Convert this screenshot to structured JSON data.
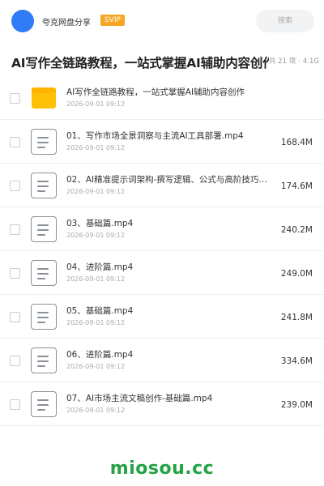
{
  "header": {
    "site_name": "夸克网盘分享",
    "badge": "SVIP",
    "search_placeholder": "搜索"
  },
  "title": "AI写作全链路教程，一站式掌握AI辅助内容创作",
  "meta": {
    "count": "共 21 项",
    "separator": "·",
    "total_size": "4.1G"
  },
  "items": [
    {
      "type": "folder",
      "icon": "folder-icon",
      "name": "AI写作全链路教程，一站式掌握AI辅助内容创作",
      "date": "2026-09-01 09:12",
      "size": ""
    },
    {
      "type": "file",
      "icon": "file-icon",
      "name": "01、写作市场全景洞察与主流AI工具部署.mp4",
      "date": "2026-09-01 09:12",
      "size": "168.4M"
    },
    {
      "type": "file",
      "icon": "file-icon",
      "name": "02、AI精准提示词架构-撰写逻辑、公式与高阶技巧…",
      "date": "2026-09-01 09:12",
      "size": "174.6M"
    },
    {
      "type": "file",
      "icon": "file-icon",
      "name": "03、基础篇.mp4",
      "date": "2026-09-01 09:12",
      "size": "240.2M"
    },
    {
      "type": "file",
      "icon": "file-icon",
      "name": "04、进阶篇.mp4",
      "date": "2026-09-01 09:12",
      "size": "249.0M"
    },
    {
      "type": "file",
      "icon": "file-icon",
      "name": "05、基础篇.mp4",
      "date": "2026-09-01 09:12",
      "size": "241.8M"
    },
    {
      "type": "file",
      "icon": "file-icon",
      "name": "06、进阶篇.mp4",
      "date": "2026-09-01 09:12",
      "size": "334.6M"
    },
    {
      "type": "file",
      "icon": "file-icon",
      "name": "07、AI市场主流文稿创作-基础篇.mp4",
      "date": "2026-09-01 09:12",
      "size": "239.0M"
    }
  ],
  "watermark": "miosou.cc",
  "colors": {
    "avatar": "#2f7cf6",
    "badge": "#f5a623",
    "folder": "#ffc107",
    "watermark": "#25a244"
  }
}
